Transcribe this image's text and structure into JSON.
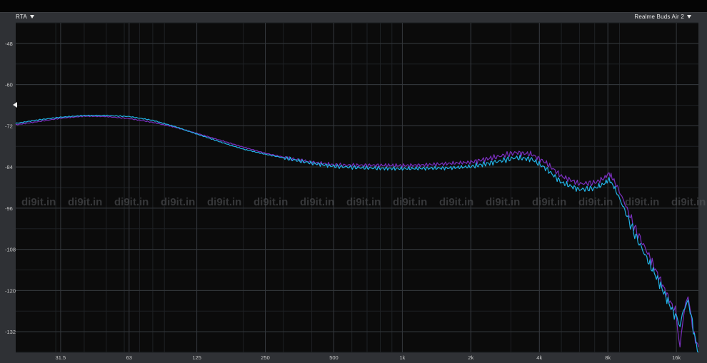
{
  "header": {
    "left_menu_label": "RTA",
    "right_menu_label": "Realme Buds Air 2"
  },
  "watermark": "di9it.in",
  "colors": {
    "background": "#0b0b0b",
    "grid": "#34383d",
    "axis_text": "#c8c8c8",
    "series_purple": "#7b2fbf",
    "series_cyan": "#22b3e6"
  },
  "chart_data": {
    "type": "line",
    "x_scale": "log",
    "xlim": [
      20,
      20000
    ],
    "ylim": [
      -138,
      -42
    ],
    "grid": true,
    "x_ticks": [
      {
        "value": 31.5,
        "label": "31.5"
      },
      {
        "value": 63,
        "label": "63"
      },
      {
        "value": 125,
        "label": "125"
      },
      {
        "value": 250,
        "label": "250"
      },
      {
        "value": 500,
        "label": "500"
      },
      {
        "value": 1000,
        "label": "1k"
      },
      {
        "value": 2000,
        "label": "2k"
      },
      {
        "value": 4000,
        "label": "4k"
      },
      {
        "value": 8000,
        "label": "8k"
      },
      {
        "value": 16000,
        "label": "16k"
      }
    ],
    "y_ticks": [
      -48,
      -60,
      -72,
      -84,
      -96,
      -108,
      -120,
      -132
    ],
    "series": [
      {
        "color": "#7b2fbf",
        "points": [
          [
            20,
            -71.7
          ],
          [
            25,
            -70.8
          ],
          [
            31.5,
            -69.8
          ],
          [
            40,
            -69.2
          ],
          [
            50,
            -69.3
          ],
          [
            63,
            -69.9
          ],
          [
            80,
            -71.0
          ],
          [
            100,
            -72.4
          ],
          [
            125,
            -74.2
          ],
          [
            160,
            -76.3
          ],
          [
            200,
            -78.2
          ],
          [
            250,
            -80.0
          ],
          [
            315,
            -81.4
          ],
          [
            400,
            -82.6
          ],
          [
            500,
            -83.4
          ],
          [
            630,
            -83.5
          ],
          [
            800,
            -83.5
          ],
          [
            1000,
            -83.6
          ],
          [
            1250,
            -83.4
          ],
          [
            1600,
            -83.0
          ],
          [
            2000,
            -82.6
          ],
          [
            2500,
            -81.3
          ],
          [
            3150,
            -79.8
          ],
          [
            3700,
            -80.3
          ],
          [
            4300,
            -82.9
          ],
          [
            5000,
            -86.7
          ],
          [
            6000,
            -88.9
          ],
          [
            7000,
            -88.6
          ],
          [
            7700,
            -87.3
          ],
          [
            8100,
            -85.8
          ],
          [
            8600,
            -88.4
          ],
          [
            9500,
            -94.6
          ],
          [
            10500,
            -101.8
          ],
          [
            12000,
            -109.2
          ],
          [
            13500,
            -116.5
          ],
          [
            15000,
            -123.2
          ],
          [
            16000,
            -126.6
          ],
          [
            16600,
            -136.4
          ],
          [
            17200,
            -127.0
          ],
          [
            18000,
            -121.2
          ],
          [
            18600,
            -128.0
          ],
          [
            19200,
            -133.6
          ],
          [
            20000,
            -136.5
          ]
        ]
      },
      {
        "color": "#22b3e6",
        "points": [
          [
            20,
            -71.3
          ],
          [
            25,
            -70.3
          ],
          [
            31.5,
            -69.5
          ],
          [
            40,
            -69.0
          ],
          [
            50,
            -69.0
          ],
          [
            63,
            -69.3
          ],
          [
            80,
            -70.4
          ],
          [
            100,
            -72.2
          ],
          [
            125,
            -74.4
          ],
          [
            160,
            -76.8
          ],
          [
            200,
            -78.8
          ],
          [
            250,
            -80.3
          ],
          [
            315,
            -81.6
          ],
          [
            400,
            -82.9
          ],
          [
            500,
            -83.8
          ],
          [
            630,
            -84.2
          ],
          [
            800,
            -84.4
          ],
          [
            1000,
            -84.5
          ],
          [
            1250,
            -84.4
          ],
          [
            1600,
            -84.3
          ],
          [
            2000,
            -83.9
          ],
          [
            2500,
            -82.7
          ],
          [
            3150,
            -81.3
          ],
          [
            3700,
            -81.7
          ],
          [
            4300,
            -84.6
          ],
          [
            5000,
            -88.5
          ],
          [
            6000,
            -90.6
          ],
          [
            7000,
            -90.2
          ],
          [
            7700,
            -88.9
          ],
          [
            8100,
            -87.6
          ],
          [
            8600,
            -90.3
          ],
          [
            9500,
            -96.7
          ],
          [
            10500,
            -103.6
          ],
          [
            12000,
            -111.3
          ],
          [
            13500,
            -117.9
          ],
          [
            15000,
            -124.4
          ],
          [
            16000,
            -128.0
          ],
          [
            16600,
            -129.5
          ],
          [
            17200,
            -125.8
          ],
          [
            18000,
            -123.0
          ],
          [
            18600,
            -127.4
          ],
          [
            19200,
            -133.0
          ],
          [
            20000,
            -138.0
          ]
        ]
      }
    ]
  }
}
